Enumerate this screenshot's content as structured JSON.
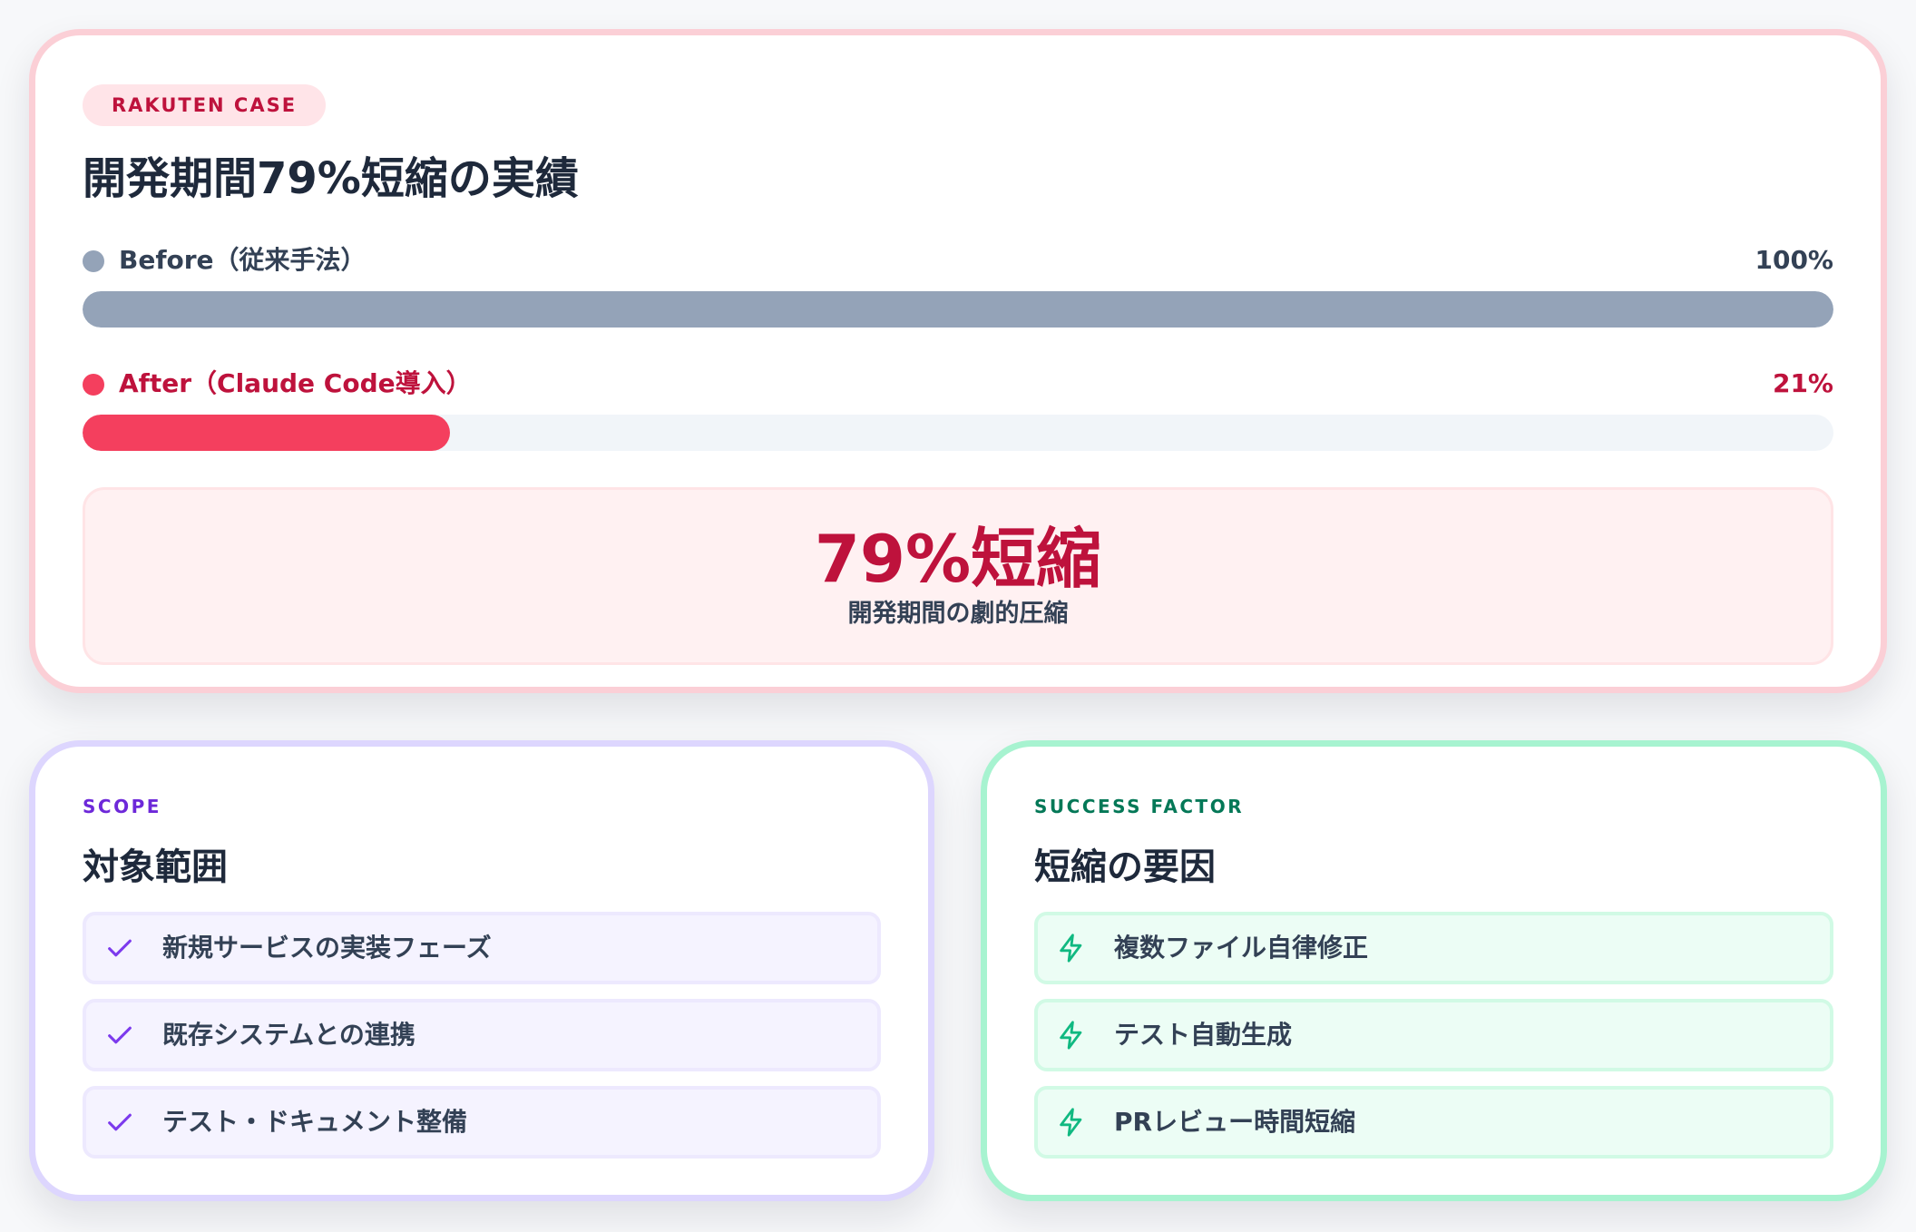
{
  "case_card": {
    "badge": "RAKUTEN CASE",
    "title": "開発期間79%短縮の実績",
    "before": {
      "label": "Before（従来手法）",
      "value_text": "100%",
      "percent": 100,
      "color": "#94a3b8",
      "label_color": "#334155"
    },
    "after": {
      "label": "After（Claude Code導入）",
      "value_text": "21%",
      "percent": 21,
      "color": "#f43f5e",
      "label_color": "#be123c"
    },
    "result": {
      "headline": "79%短縮",
      "caption": "開発期間の劇的圧縮"
    }
  },
  "scope_card": {
    "eyebrow": "SCOPE",
    "eyebrow_color": "#6d28d9",
    "title": "対象範囲",
    "icon": "check-icon",
    "icon_color": "#7c3aed",
    "items": [
      "新規サービスの実装フェーズ",
      "既存システムとの連携",
      "テスト・ドキュメント整備"
    ]
  },
  "success_card": {
    "eyebrow": "SUCCESS FACTOR",
    "eyebrow_color": "#047857",
    "title": "短縮の要因",
    "icon": "lightning-icon",
    "icon_color": "#10b981",
    "items": [
      "複数ファイル自律修正",
      "テスト自動生成",
      "PRレビュー時間短縮"
    ]
  }
}
